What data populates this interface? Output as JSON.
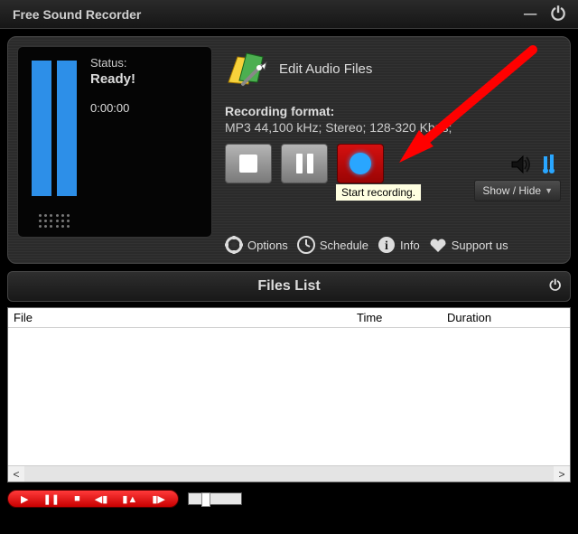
{
  "app_title": "Free Sound Recorder",
  "status": {
    "label": "Status:",
    "value": "Ready!",
    "time": "0:00:00"
  },
  "edit_files_label": "Edit Audio Files",
  "recording_format": {
    "label": "Recording format:",
    "value": "MP3 44,100 kHz; Stereo;  128-320 Kbps;"
  },
  "buttons": {
    "stop_name": "stop",
    "pause_name": "pause",
    "record_name": "record",
    "record_tooltip": "Start recording."
  },
  "show_hide_label": "Show / Hide",
  "menu": {
    "options": "Options",
    "schedule": "Schedule",
    "info": "Info",
    "support": "Support us"
  },
  "files_list": {
    "header": "Files List",
    "columns": {
      "file": "File",
      "time": "Time",
      "duration": "Duration"
    },
    "rows": []
  }
}
